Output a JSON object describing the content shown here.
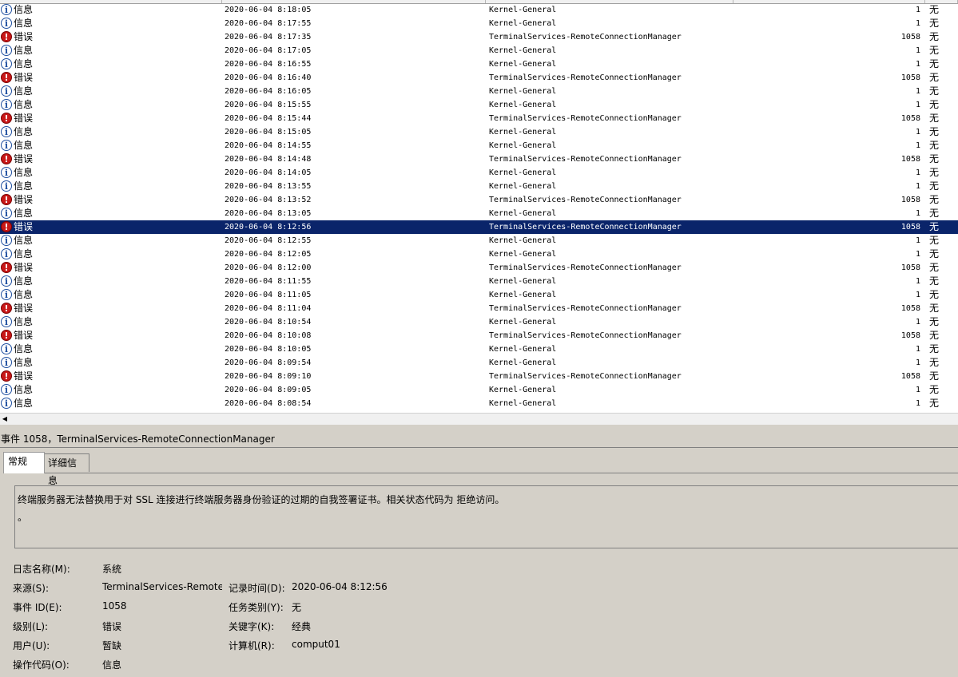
{
  "rows": [
    {
      "type": "info",
      "level": "信息",
      "date": "2020-06-04 8:18:05",
      "source": "Kernel-General",
      "id": "1",
      "task": "无"
    },
    {
      "type": "info",
      "level": "信息",
      "date": "2020-06-04 8:17:55",
      "source": "Kernel-General",
      "id": "1",
      "task": "无"
    },
    {
      "type": "error",
      "level": "错误",
      "date": "2020-06-04 8:17:35",
      "source": "TerminalServices-RemoteConnectionManager",
      "id": "1058",
      "task": "无"
    },
    {
      "type": "info",
      "level": "信息",
      "date": "2020-06-04 8:17:05",
      "source": "Kernel-General",
      "id": "1",
      "task": "无"
    },
    {
      "type": "info",
      "level": "信息",
      "date": "2020-06-04 8:16:55",
      "source": "Kernel-General",
      "id": "1",
      "task": "无"
    },
    {
      "type": "error",
      "level": "错误",
      "date": "2020-06-04 8:16:40",
      "source": "TerminalServices-RemoteConnectionManager",
      "id": "1058",
      "task": "无"
    },
    {
      "type": "info",
      "level": "信息",
      "date": "2020-06-04 8:16:05",
      "source": "Kernel-General",
      "id": "1",
      "task": "无"
    },
    {
      "type": "info",
      "level": "信息",
      "date": "2020-06-04 8:15:55",
      "source": "Kernel-General",
      "id": "1",
      "task": "无"
    },
    {
      "type": "error",
      "level": "错误",
      "date": "2020-06-04 8:15:44",
      "source": "TerminalServices-RemoteConnectionManager",
      "id": "1058",
      "task": "无"
    },
    {
      "type": "info",
      "level": "信息",
      "date": "2020-06-04 8:15:05",
      "source": "Kernel-General",
      "id": "1",
      "task": "无"
    },
    {
      "type": "info",
      "level": "信息",
      "date": "2020-06-04 8:14:55",
      "source": "Kernel-General",
      "id": "1",
      "task": "无"
    },
    {
      "type": "error",
      "level": "错误",
      "date": "2020-06-04 8:14:48",
      "source": "TerminalServices-RemoteConnectionManager",
      "id": "1058",
      "task": "无"
    },
    {
      "type": "info",
      "level": "信息",
      "date": "2020-06-04 8:14:05",
      "source": "Kernel-General",
      "id": "1",
      "task": "无"
    },
    {
      "type": "info",
      "level": "信息",
      "date": "2020-06-04 8:13:55",
      "source": "Kernel-General",
      "id": "1",
      "task": "无"
    },
    {
      "type": "error",
      "level": "错误",
      "date": "2020-06-04 8:13:52",
      "source": "TerminalServices-RemoteConnectionManager",
      "id": "1058",
      "task": "无"
    },
    {
      "type": "info",
      "level": "信息",
      "date": "2020-06-04 8:13:05",
      "source": "Kernel-General",
      "id": "1",
      "task": "无"
    },
    {
      "type": "error",
      "level": "错误",
      "date": "2020-06-04 8:12:56",
      "source": "TerminalServices-RemoteConnectionManager",
      "id": "1058",
      "task": "无",
      "selected": true
    },
    {
      "type": "info",
      "level": "信息",
      "date": "2020-06-04 8:12:55",
      "source": "Kernel-General",
      "id": "1",
      "task": "无"
    },
    {
      "type": "info",
      "level": "信息",
      "date": "2020-06-04 8:12:05",
      "source": "Kernel-General",
      "id": "1",
      "task": "无"
    },
    {
      "type": "error",
      "level": "错误",
      "date": "2020-06-04 8:12:00",
      "source": "TerminalServices-RemoteConnectionManager",
      "id": "1058",
      "task": "无"
    },
    {
      "type": "info",
      "level": "信息",
      "date": "2020-06-04 8:11:55",
      "source": "Kernel-General",
      "id": "1",
      "task": "无"
    },
    {
      "type": "info",
      "level": "信息",
      "date": "2020-06-04 8:11:05",
      "source": "Kernel-General",
      "id": "1",
      "task": "无"
    },
    {
      "type": "error",
      "level": "错误",
      "date": "2020-06-04 8:11:04",
      "source": "TerminalServices-RemoteConnectionManager",
      "id": "1058",
      "task": "无"
    },
    {
      "type": "info",
      "level": "信息",
      "date": "2020-06-04 8:10:54",
      "source": "Kernel-General",
      "id": "1",
      "task": "无"
    },
    {
      "type": "error",
      "level": "错误",
      "date": "2020-06-04 8:10:08",
      "source": "TerminalServices-RemoteConnectionManager",
      "id": "1058",
      "task": "无"
    },
    {
      "type": "info",
      "level": "信息",
      "date": "2020-06-04 8:10:05",
      "source": "Kernel-General",
      "id": "1",
      "task": "无"
    },
    {
      "type": "info",
      "level": "信息",
      "date": "2020-06-04 8:09:54",
      "source": "Kernel-General",
      "id": "1",
      "task": "无"
    },
    {
      "type": "error",
      "level": "错误",
      "date": "2020-06-04 8:09:10",
      "source": "TerminalServices-RemoteConnectionManager",
      "id": "1058",
      "task": "无"
    },
    {
      "type": "info",
      "level": "信息",
      "date": "2020-06-04 8:09:05",
      "source": "Kernel-General",
      "id": "1",
      "task": "无"
    },
    {
      "type": "info",
      "level": "信息",
      "date": "2020-06-04 8:08:54",
      "source": "Kernel-General",
      "id": "1",
      "task": "无"
    }
  ],
  "icons": {
    "info": "info-icon",
    "error": "error-icon"
  },
  "colors": {
    "selection": "#0a246a",
    "error": "#c81818",
    "info": "#1f4fa0",
    "pane": "#d4d0c8"
  },
  "detail": {
    "title": "事件 1058，TerminalServices-RemoteConnectionManager",
    "tabs": [
      "常规",
      "详细信息"
    ],
    "message": "终端服务器无法替换用于对 SSL 连接进行终端服务器身份验证的过期的自我签署证书。相关状态代码为 拒绝访问。",
    "message_tail": "。",
    "log_name_label": "日志名称(M):",
    "log_name": "系统",
    "source_label": "来源(S):",
    "source": "TerminalServices-RemoteConnectionManager",
    "logged_label": "记录时间(D):",
    "logged": "2020-06-04 8:12:56",
    "event_id_label": "事件 ID(E):",
    "event_id": "1058",
    "task_label": "任务类别(Y):",
    "task": "无",
    "level_label": "级别(L):",
    "level": "错误",
    "keywords_label": "关键字(K):",
    "keywords": "经典",
    "user_label": "用户(U):",
    "user": "暂缺",
    "computer_label": "计算机(R):",
    "computer": "comput01",
    "opcode_label": "操作代码(O):",
    "opcode": "信息"
  }
}
